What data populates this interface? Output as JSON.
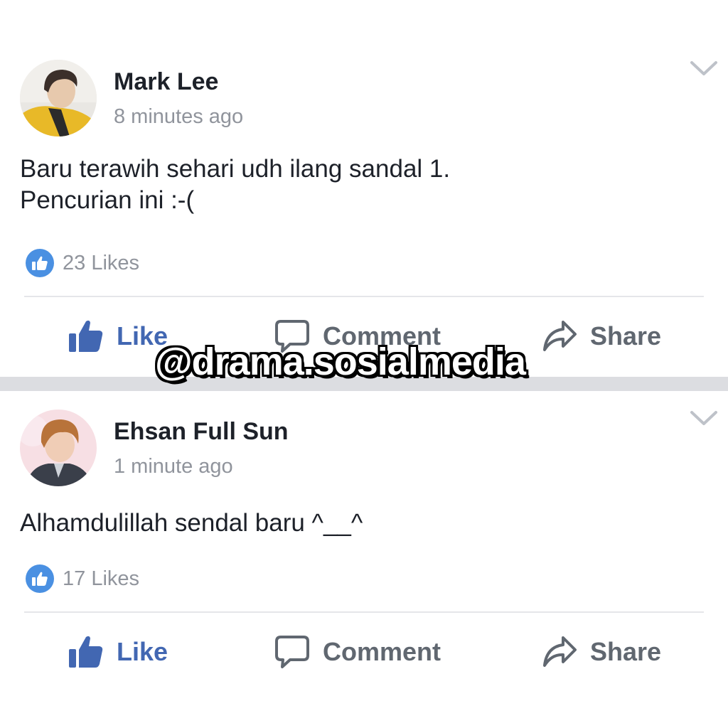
{
  "posts": [
    {
      "author": "Mark Lee",
      "time": "8 minutes ago",
      "text_lines": [
        "Baru terawih sehari udh ilang sandal 1.",
        "Pencurian ini :-("
      ],
      "likes": "23 Likes",
      "actions": {
        "like": "Like",
        "comment": "Comment",
        "share": "Share"
      }
    },
    {
      "author": "Ehsan Full Sun",
      "time": "1 minute ago",
      "text_lines": [
        "Alhamdulillah sendal baru ^__^"
      ],
      "likes": "17 Likes",
      "actions": {
        "like": "Like",
        "comment": "Comment",
        "share": "Share"
      }
    }
  ],
  "watermark": "@drama.sosialmedia",
  "icons": {
    "like": "thumbs-up-icon",
    "comment": "speech-bubble-icon",
    "share": "share-arrow-icon",
    "menu": "chevron-down-icon"
  },
  "colors": {
    "like_blue": "#4267b2",
    "badge_blue": "#4a90e2",
    "muted_text": "#90949c",
    "action_gray": "#606770",
    "separator": "#dcdde1"
  }
}
